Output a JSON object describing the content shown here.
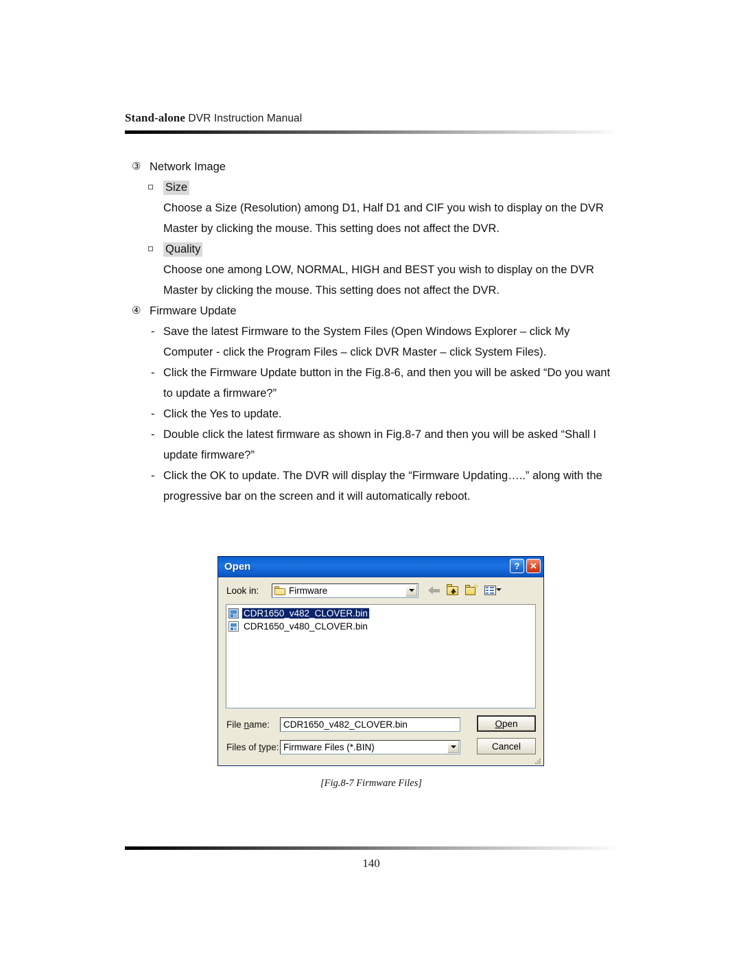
{
  "header": {
    "title_bold": "Stand-alone",
    "title_rest": " DVR Instruction Manual"
  },
  "sections": {
    "s3": {
      "marker": "③",
      "title": "Network Image",
      "sub1": {
        "label": "Size",
        "lines": [
          "Choose a Size (Resolution) among D1, Half D1 and CIF you wish to display on the DVR",
          "Master by clicking the mouse. This setting does not affect the DVR."
        ]
      },
      "sub2": {
        "label": "Quality",
        "lines": [
          "Choose one among LOW, NORMAL, HIGH and BEST you wish to display on the DVR",
          "Master by clicking the mouse. This setting does not affect the DVR."
        ]
      }
    },
    "s4": {
      "marker": "④",
      "title": "Firmware Update",
      "dash": "-",
      "items": [
        [
          "Save the latest Firmware to the System Files (Open Windows Explorer – click My",
          "Computer - click the Program Files – click DVR Master – click System Files)."
        ],
        [
          "Click the Firmware Update button in the Fig.8-6, and then you will be asked “Do you want",
          "to update a firmware?”"
        ],
        [
          "Click the Yes to update."
        ],
        [
          "Double click the latest firmware as shown in Fig.8-7 and then you will be asked “Shall I",
          "update firmware?”"
        ],
        [
          "Click the OK to update. The DVR will display the “Firmware Updating…..” along with the",
          "progressive bar on the screen and it will automatically reboot."
        ]
      ]
    }
  },
  "dialog": {
    "title": "Open",
    "help_button": "?",
    "close_button": "✕",
    "lookin_label": "Look in:",
    "lookin_value": "Firmware",
    "toolbar": {
      "back": "back-arrow",
      "up": "up-one-level",
      "new_folder": "create-new-folder",
      "views": "views-menu"
    },
    "files": [
      {
        "name": "CDR1650_v482_CLOVER.bin",
        "selected": true
      },
      {
        "name": "CDR1650_v480_CLOVER.bin",
        "selected": false
      }
    ],
    "filename_label_a": "File ",
    "filename_label_u": "n",
    "filename_label_b": "ame:",
    "filename_value": "CDR1650_v482_CLOVER.bin",
    "filetype_label_a": "Files of ",
    "filetype_label_u": "t",
    "filetype_label_b": "ype:",
    "filetype_value": "Firmware Files (*.BIN)",
    "open_button_u": "O",
    "open_button_rest": "pen",
    "cancel_button": "Cancel"
  },
  "caption": "[Fig.8-7 Firmware Files]",
  "footer": {
    "page_number": "140"
  },
  "colors": {
    "title_bar_blue": "#1c73e0",
    "dialog_face": "#ece9d8",
    "selection_blue": "#0a246a",
    "highlight_gray": "#d9d9d9",
    "close_red": "#e2502a"
  }
}
